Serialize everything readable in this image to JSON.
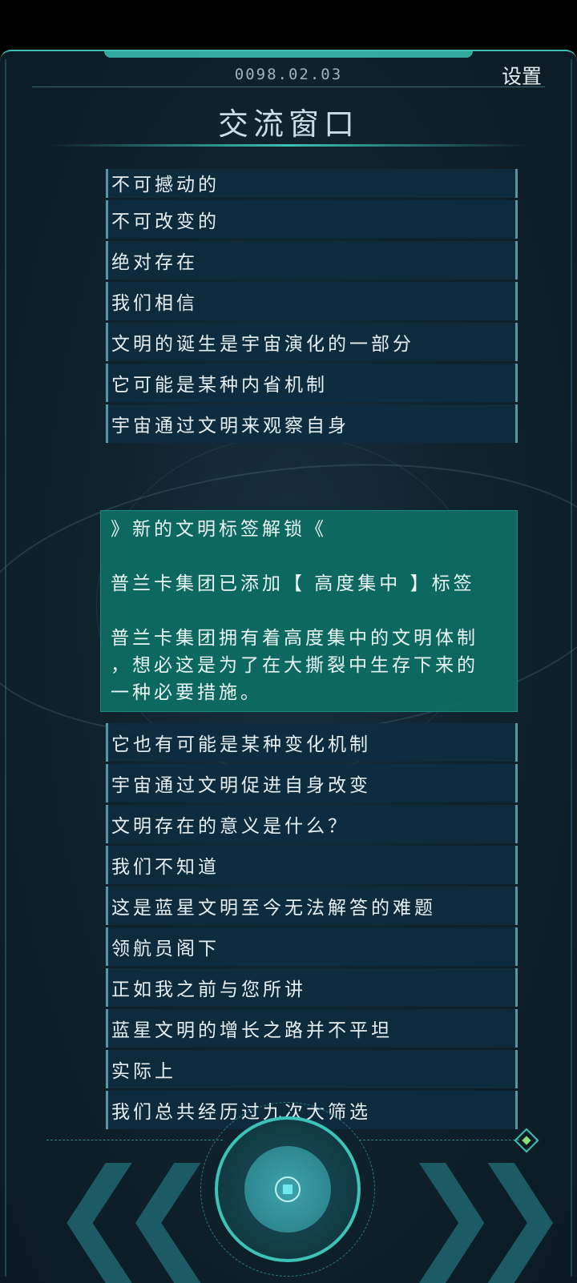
{
  "header": {
    "date": "0098.02.03",
    "settings_label": "设置",
    "title": "交流窗口"
  },
  "messages_before": [
    "不可撼动的",
    "不可改变的",
    "绝对存在",
    "我们相信",
    "文明的诞生是宇宙演化的一部分",
    "它可能是某种内省机制",
    "宇宙通过文明来观察自身"
  ],
  "notice": {
    "header": "》新的文明标签解锁《",
    "tag_line": "普兰卡集团已添加【 高度集中 】标签",
    "body_line1": "普兰卡集团拥有着高度集中的文明体制",
    "body_line2": "，想必这是为了在大撕裂中生存下来的",
    "body_line3": "一种必要措施。"
  },
  "messages_after": [
    "它也有可能是某种变化机制",
    "宇宙通过文明促进自身改变",
    "文明存在的意义是什么？",
    "我们不知道",
    "这是蓝星文明至今无法解答的难题",
    "领航员阁下",
    "正如我之前与您所讲",
    "蓝星文明的增长之路并不平坦",
    "实际上",
    "我们总共经历过九次大筛选"
  ],
  "controls": {
    "prev_icon": "double-chevron-left-icon",
    "next_icon": "double-chevron-right-icon",
    "center_icon": "center-dial-button",
    "corner_icon": "diamond-indicator-icon"
  },
  "colors": {
    "accent": "#3cc2b6",
    "row_bg": "#0e2c40",
    "notice_bg": "#0d6e64"
  }
}
